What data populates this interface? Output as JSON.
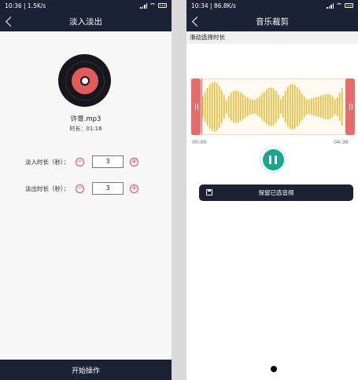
{
  "left": {
    "status": {
      "time_speed": "10:36 | 1.5K/s"
    },
    "title": "淡入淡出",
    "file": {
      "name": "许哥.mp3",
      "duration": "时长：01:16"
    },
    "fade_in": {
      "label": "淡入时长（秒）：",
      "value": "3"
    },
    "fade_out": {
      "label": "淡出时长（秒）：",
      "value": "3"
    },
    "start_button": "开始操作"
  },
  "right": {
    "status": {
      "time_speed": "10:34 | 86.8K/s"
    },
    "title": "音乐裁剪",
    "hint": "滑动选择时长",
    "time_start": "00:00",
    "time_end": "04:36",
    "save_button": "保留已选音频"
  },
  "icons": {
    "minus": "−",
    "plus": "+"
  },
  "colors": {
    "navbar": "#1b2236",
    "accent_red": "#e04848",
    "handle": "#e86a6a",
    "wave": "#f5b92f",
    "play_green": "#1aa78d"
  }
}
